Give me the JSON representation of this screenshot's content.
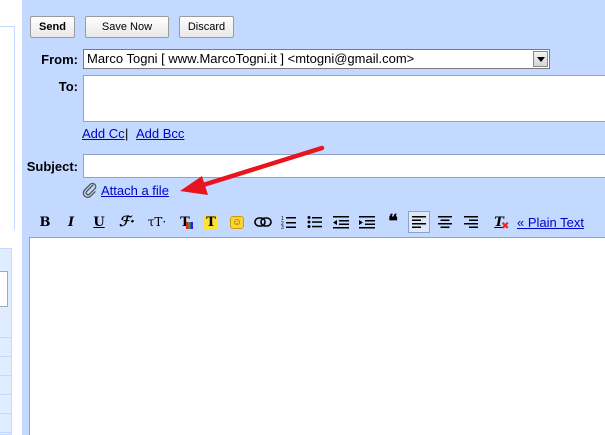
{
  "toolbar_buttons": {
    "send": "Send",
    "save_now": "Save Now",
    "discard": "Discard"
  },
  "fields": {
    "from_label": "From:",
    "from_value": "Marco Togni [ www.MarcoTogni.it ] <mtogni@gmail.com>",
    "to_label": "To:",
    "to_value": "",
    "subject_label": "Subject:",
    "subject_value": ""
  },
  "links": {
    "add_cc": "Add Cc",
    "separator": "|",
    "add_bcc": "Add Bcc",
    "attach_file": "Attach a file",
    "plain_text": "« Plain Text"
  },
  "format_toolbar": [
    {
      "icon": "bold-icon",
      "glyph": "B"
    },
    {
      "icon": "italic-icon",
      "glyph": "I"
    },
    {
      "icon": "underline-icon",
      "glyph": "U"
    },
    {
      "icon": "font-icon",
      "glyph": "ℱ·"
    },
    {
      "icon": "font-size-icon",
      "glyph": "τT·"
    },
    {
      "icon": "text-color-icon",
      "glyph": "T"
    },
    {
      "icon": "highlight-color-icon",
      "glyph": "T"
    },
    {
      "icon": "smiley-icon",
      "glyph": "☺"
    },
    {
      "icon": "link-icon",
      "glyph": "∞"
    },
    {
      "icon": "numbered-list-icon",
      "glyph": "☰"
    },
    {
      "icon": "bulleted-list-icon",
      "glyph": "☰"
    },
    {
      "icon": "indent-less-icon",
      "glyph": "⇤"
    },
    {
      "icon": "indent-more-icon",
      "glyph": "⇥"
    },
    {
      "icon": "quote-icon",
      "glyph": "❝"
    },
    {
      "icon": "align-left-icon",
      "glyph": "≡"
    },
    {
      "icon": "align-center-icon",
      "glyph": "≡"
    },
    {
      "icon": "align-right-icon",
      "glyph": "≡"
    },
    {
      "icon": "remove-formatting-icon",
      "glyph": "T"
    }
  ],
  "colors": {
    "panel": "#c3d9ff",
    "link": "#0000cc",
    "annotation_arrow": "#e8141e"
  }
}
